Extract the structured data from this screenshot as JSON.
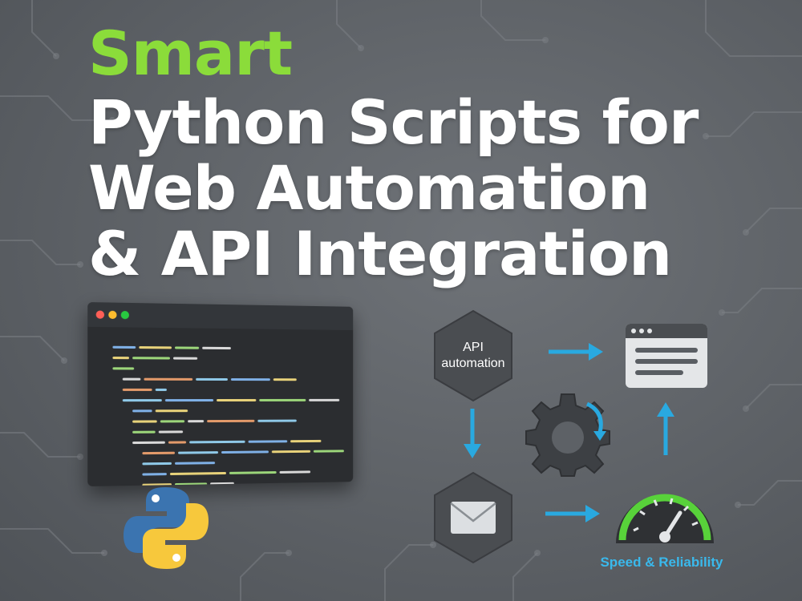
{
  "headline": {
    "accent": "Smart",
    "lines": [
      "Python Scripts for",
      "Web Automation",
      "& API Integration"
    ]
  },
  "diagram": {
    "api_node_line1": "API",
    "api_node_line2": "automation",
    "speed_label": "Speed & Reliability"
  },
  "icons": {
    "api_node": "hexagon-node",
    "browser": "browser-window-icon",
    "email": "envelope-icon",
    "gear": "gear-icon",
    "speedometer": "speedometer-icon",
    "logo": "python-logo"
  },
  "colors": {
    "accent_green": "#8bdc3a",
    "arrow_blue": "#29a9e0",
    "label_blue": "#3ab9ec",
    "python_blue": "#3b74b0",
    "python_yellow": "#f7c83c",
    "gauge_green": "#58d23a"
  }
}
